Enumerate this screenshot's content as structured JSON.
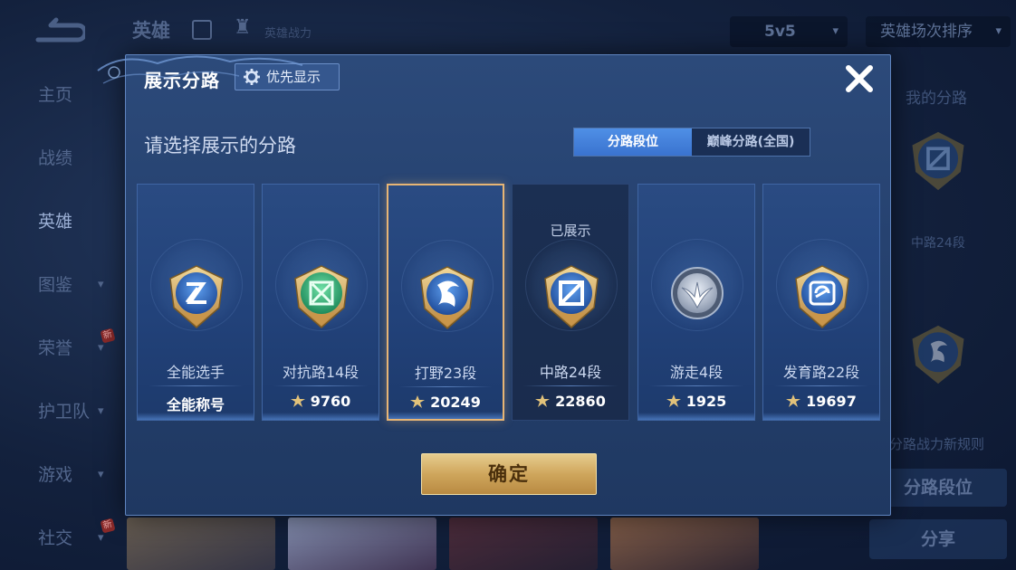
{
  "app": {
    "title": "英雄",
    "subtitle": "英雄战力",
    "mode_select": "5v5",
    "sort_select": "英雄场次排序"
  },
  "sidebar": {
    "items": [
      {
        "label": "主页",
        "chevron": false,
        "badge": ""
      },
      {
        "label": "战绩",
        "chevron": false,
        "badge": ""
      },
      {
        "label": "英雄",
        "chevron": false,
        "badge": ""
      },
      {
        "label": "图鉴",
        "chevron": true,
        "badge": ""
      },
      {
        "label": "荣誉",
        "chevron": true,
        "badge": "新"
      },
      {
        "label": "护卫队",
        "chevron": true,
        "badge": ""
      },
      {
        "label": "游戏",
        "chevron": true,
        "badge": ""
      },
      {
        "label": "社交",
        "chevron": true,
        "badge": "新"
      }
    ]
  },
  "right_panel": {
    "title": "我的分路",
    "rank_label": "中路24段",
    "rule_text": "分路战力新规则",
    "rank_button": "分路段位",
    "share_button": "分享"
  },
  "modal": {
    "title": "展示分路",
    "priority_button": "优先显示",
    "prompt": "请选择展示的分路",
    "tabs": [
      {
        "label": "分路段位",
        "active": true
      },
      {
        "label": "巅峰分路(全国)",
        "active": false
      }
    ],
    "cards": [
      {
        "title": "全能选手",
        "value": "全能称号",
        "show_power_icon": false,
        "shown_label": "",
        "emblem": "all-round-emblem-icon",
        "state": "normal"
      },
      {
        "title": "对抗路14段",
        "value": "9760",
        "show_power_icon": true,
        "shown_label": "",
        "emblem": "clash-lane-emblem-icon",
        "state": "normal"
      },
      {
        "title": "打野23段",
        "value": "20249",
        "show_power_icon": true,
        "shown_label": "",
        "emblem": "jungle-emblem-icon",
        "state": "selected"
      },
      {
        "title": "中路24段",
        "value": "22860",
        "show_power_icon": true,
        "shown_label": "已展示",
        "emblem": "mid-lane-emblem-icon",
        "state": "dim"
      },
      {
        "title": "游走4段",
        "value": "1925",
        "show_power_icon": true,
        "shown_label": "",
        "emblem": "roam-emblem-icon",
        "state": "normal"
      },
      {
        "title": "发育路22段",
        "value": "19697",
        "show_power_icon": true,
        "shown_label": "",
        "emblem": "farm-lane-emblem-icon",
        "state": "normal"
      }
    ],
    "confirm_button": "确定"
  },
  "colors": {
    "gold": "#e7b575",
    "tab_active": "#3a73cf",
    "modal_bg": "#264270"
  }
}
